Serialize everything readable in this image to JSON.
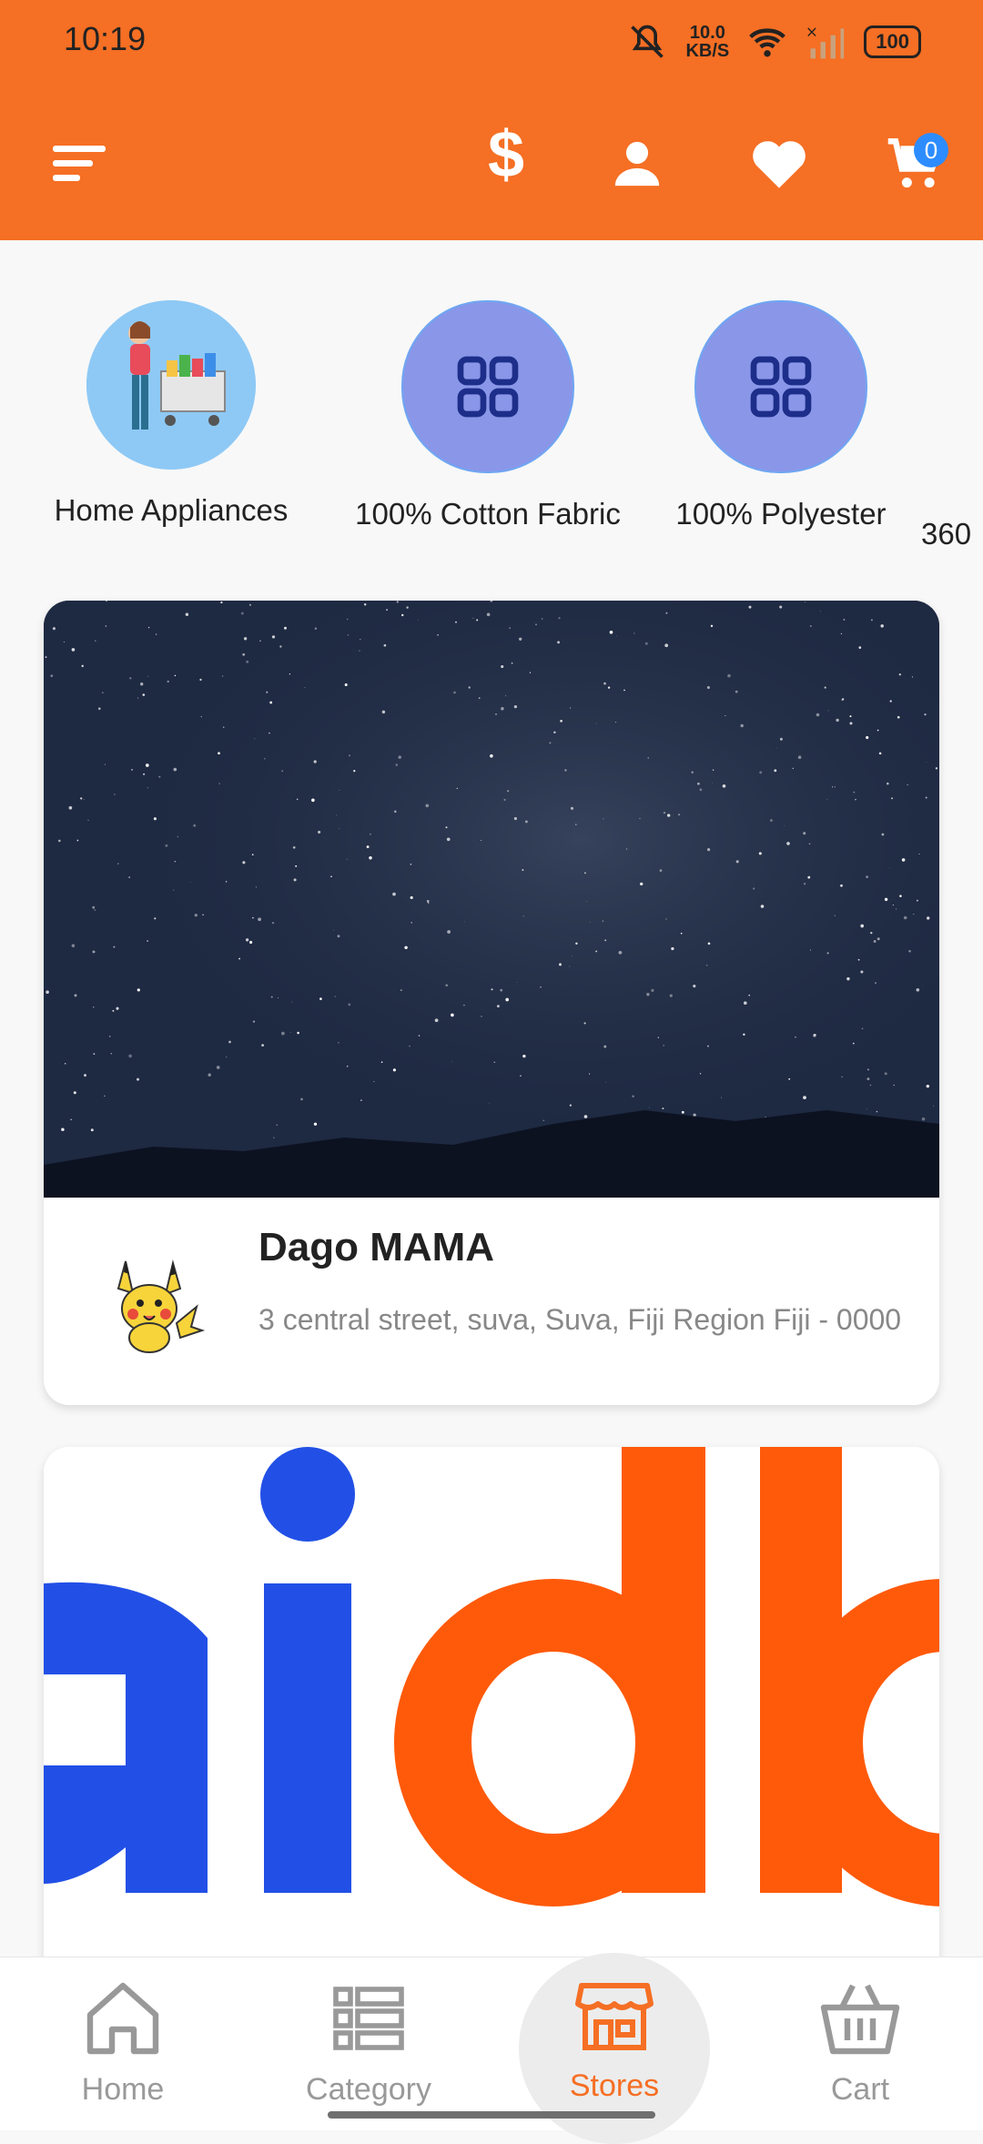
{
  "status_bar": {
    "time": "10:19",
    "network_speed": "10.0",
    "network_unit": "KB/S",
    "battery": "100"
  },
  "toolbar": {
    "cart_count": "0",
    "currency_symbol": "$",
    "colors": {
      "primary": "#f56f24",
      "badge": "#2d8cff"
    }
  },
  "categories": [
    {
      "name": "Home Appliances",
      "icon": "shopping-woman-image"
    },
    {
      "name": "100% Cotton Fabric",
      "icon": "grid-icon"
    },
    {
      "name": "100% Polyester",
      "icon": "grid-icon"
    },
    {
      "name": "360",
      "icon": "partially-visible"
    }
  ],
  "stores": [
    {
      "name": "Dago MAMA",
      "address": "3 central street, suva, Suva, Fiji Region Fiji - 0000",
      "banner": "night-sky-stars-image",
      "avatar": "pikachu-logo"
    },
    {
      "name": "",
      "banner": "aida-logo-banner"
    }
  ],
  "bottom_nav": [
    {
      "label": "Home",
      "icon": "home-icon"
    },
    {
      "label": "Category",
      "icon": "list-icon"
    },
    {
      "label": "Stores",
      "icon": "store-icon",
      "selected": true
    },
    {
      "label": "Cart",
      "icon": "basket-icon"
    }
  ]
}
